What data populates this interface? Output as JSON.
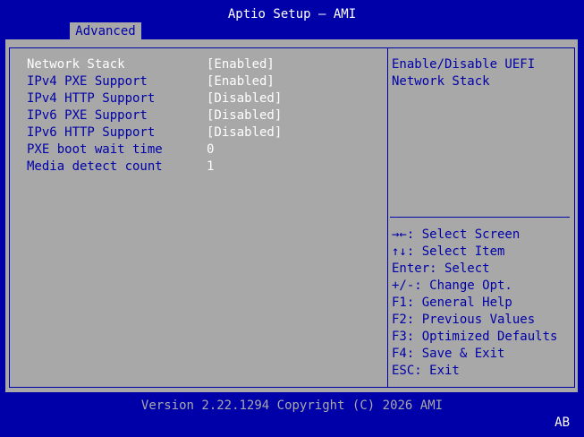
{
  "header": {
    "title": "Aptio Setup – AMI",
    "active_tab": "Advanced"
  },
  "settings": [
    {
      "label": "Network Stack",
      "value": "[Enabled]",
      "selected": true
    },
    {
      "label": "IPv4 PXE Support",
      "value": "[Enabled]",
      "selected": false
    },
    {
      "label": "IPv4 HTTP Support",
      "value": "[Disabled]",
      "selected": false
    },
    {
      "label": "IPv6 PXE Support",
      "value": "[Disabled]",
      "selected": false
    },
    {
      "label": "IPv6 HTTP Support",
      "value": "[Disabled]",
      "selected": false
    },
    {
      "label": "PXE boot wait time",
      "value": "0",
      "selected": false
    },
    {
      "label": "Media detect count",
      "value": "1",
      "selected": false
    }
  ],
  "help": {
    "line1": "Enable/Disable UEFI",
    "line2": "Network Stack"
  },
  "keys": [
    "→←: Select Screen",
    "↑↓: Select Item",
    "Enter: Select",
    "+/-: Change Opt.",
    "F1: General Help",
    "F2: Previous Values",
    "F3: Optimized Defaults",
    "F4: Save & Exit",
    "ESC: Exit"
  ],
  "footer": {
    "version": "Version 2.22.1294 Copyright (C) 2026 AMI",
    "mode": "AB"
  },
  "colors": {
    "background": "#0000a8",
    "panel": "#a8a8a8",
    "highlight": "#ffffff"
  }
}
